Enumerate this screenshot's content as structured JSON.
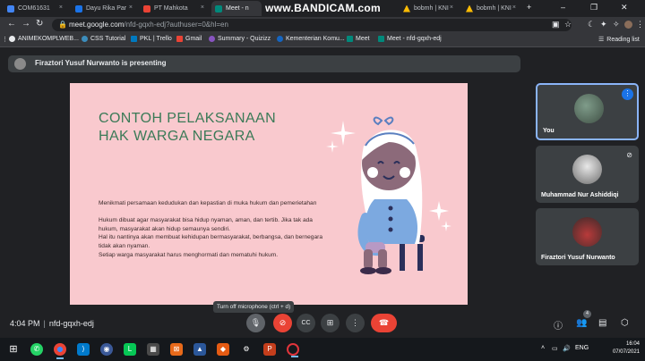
{
  "browser": {
    "tabs": [
      {
        "title": "COM61631",
        "close": "×",
        "color": "#4285f4"
      },
      {
        "title": "Dayu Rika Par",
        "close": "×",
        "color": "#1a73e8"
      },
      {
        "title": "PT Mahkota",
        "close": "×",
        "color": "#ea4335"
      },
      {
        "title": "Meet - n",
        "close": "×",
        "color": "#00897b"
      },
      {
        "title": "bobmh | KNI",
        "close": "×",
        "color": "#fbbc04"
      },
      {
        "title": "bobmh | KNI",
        "close": "×",
        "color": "#fbbc04"
      }
    ],
    "new_tab": "+",
    "address": {
      "lock": "🔒",
      "host": "meet.google.com",
      "path": "/nfd-gqxh-edj?authuser=0&hl=en"
    },
    "bookmarks": [
      {
        "label": "ANIMEKOMPLWEB...",
        "color": "#e8eaed"
      },
      {
        "label": "CSS Tutorial",
        "color": "#3c8dbc"
      },
      {
        "label": "PKL | Trello",
        "color": "#0079bf"
      },
      {
        "label": "Gmail",
        "color": "#ea4335"
      },
      {
        "label": "Summary - Quizizz",
        "color": "#8854c0"
      },
      {
        "label": "Kementerian Komu...",
        "color": "#1565c0"
      },
      {
        "label": "Meet",
        "color": "#00897b"
      },
      {
        "label": "Meet - nfd-gqxh-edj",
        "color": "#00897b"
      }
    ],
    "reading_list": "Reading list"
  },
  "watermark": "www.BANDICAM.com",
  "meet": {
    "presenting_text": "Firaztori Yusuf Nurwanto is presenting",
    "slide": {
      "title_line1": "CONTOH PELAKSANAAN",
      "title_line2": "HAK WARGA NEGARA",
      "para1": "Menikmati persamaan kedudukan dan kepastian di muka hukum dan pemerietahan",
      "para2": "Hukum dibuat agar masyarakat bisa hidup nyaman, aman, dan tertib. Jika tak ada hukum, masyarakat akan hidup semaunya sendiri.",
      "para3": "Hal itu nantinya akan membuat kehidupan bermasyarakat, berbangsa, dan bernegara tidak akan nyaman.",
      "para4": "Setiap warga masyarakat harus menghormati dan mematuhi hukum."
    },
    "participants": [
      {
        "name": "You",
        "more": "⋮"
      },
      {
        "name": "Muhammad Nur Ashiddiqi",
        "mic": "🎤"
      },
      {
        "name": "Firaztori Yusuf Nurwanto"
      }
    ],
    "time": "4:04 PM",
    "meeting_code": "nfd-gqxh-edj",
    "tooltip": "Turn off microphone (ctrl + d)",
    "participant_count": "4"
  },
  "taskbar": {
    "lang": "ENG",
    "clock_time": "16:04",
    "clock_date": "07/07/2021"
  },
  "colors": {
    "slide_bg": "#f9c9ce",
    "title_green": "#3b7a57",
    "meet_bg": "#202124",
    "hangup_red": "#ea4335"
  }
}
